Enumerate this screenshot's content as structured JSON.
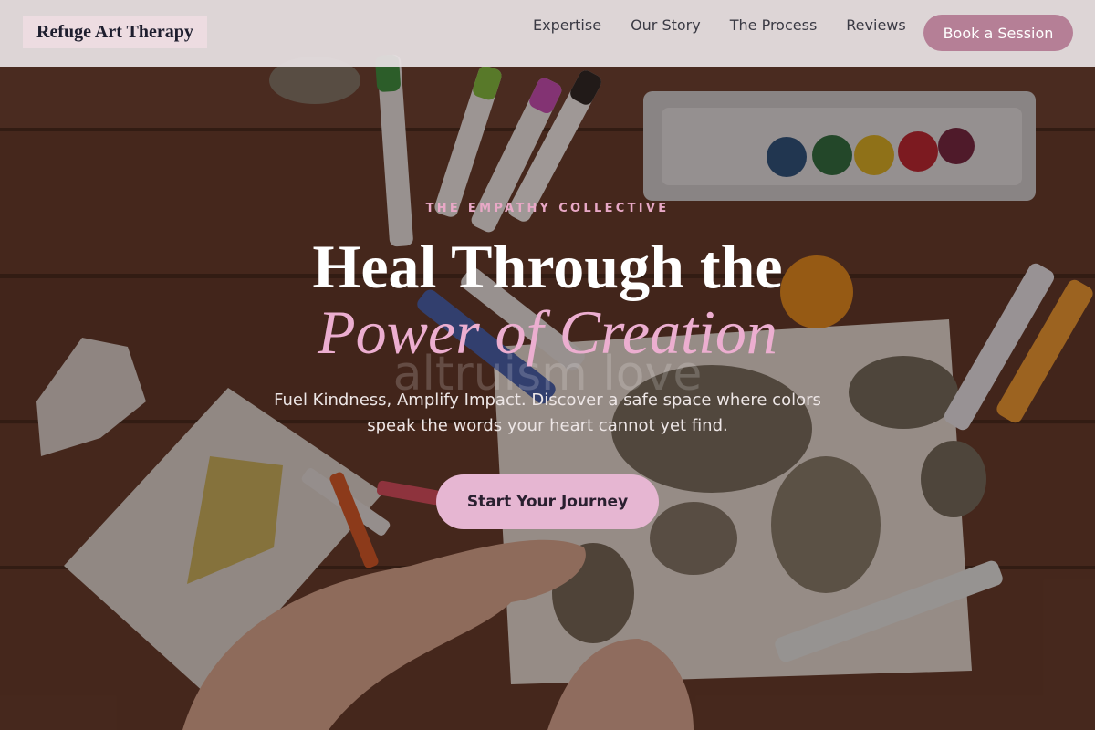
{
  "header": {
    "brand": "Refuge Art Therapy",
    "nav": [
      {
        "label": "Expertise"
      },
      {
        "label": "Our Story"
      },
      {
        "label": "The Process"
      },
      {
        "label": "Reviews"
      }
    ],
    "cta_label": "Book a Session"
  },
  "hero": {
    "eyebrow": "THE EMPATHY COLLECTIVE",
    "title_line1": "Heal Through the",
    "title_line2": "Power of Creation",
    "watermark": "altruism love",
    "subtitle": "Fuel Kindness, Amplify Impact. Discover a safe space where colors speak the words your heart cannot yet find.",
    "cta_label": "Start Your Journey"
  },
  "colors": {
    "brand_accent": "#b57f96",
    "hero_accent_pink": "#ecaed0",
    "cta_button": "#e6b6d2",
    "navbar_bg": "#e8e2e4"
  },
  "background_image": "children's art supplies on a wooden table (markers, watercolor palette, painted rocks, coloring sheet)"
}
